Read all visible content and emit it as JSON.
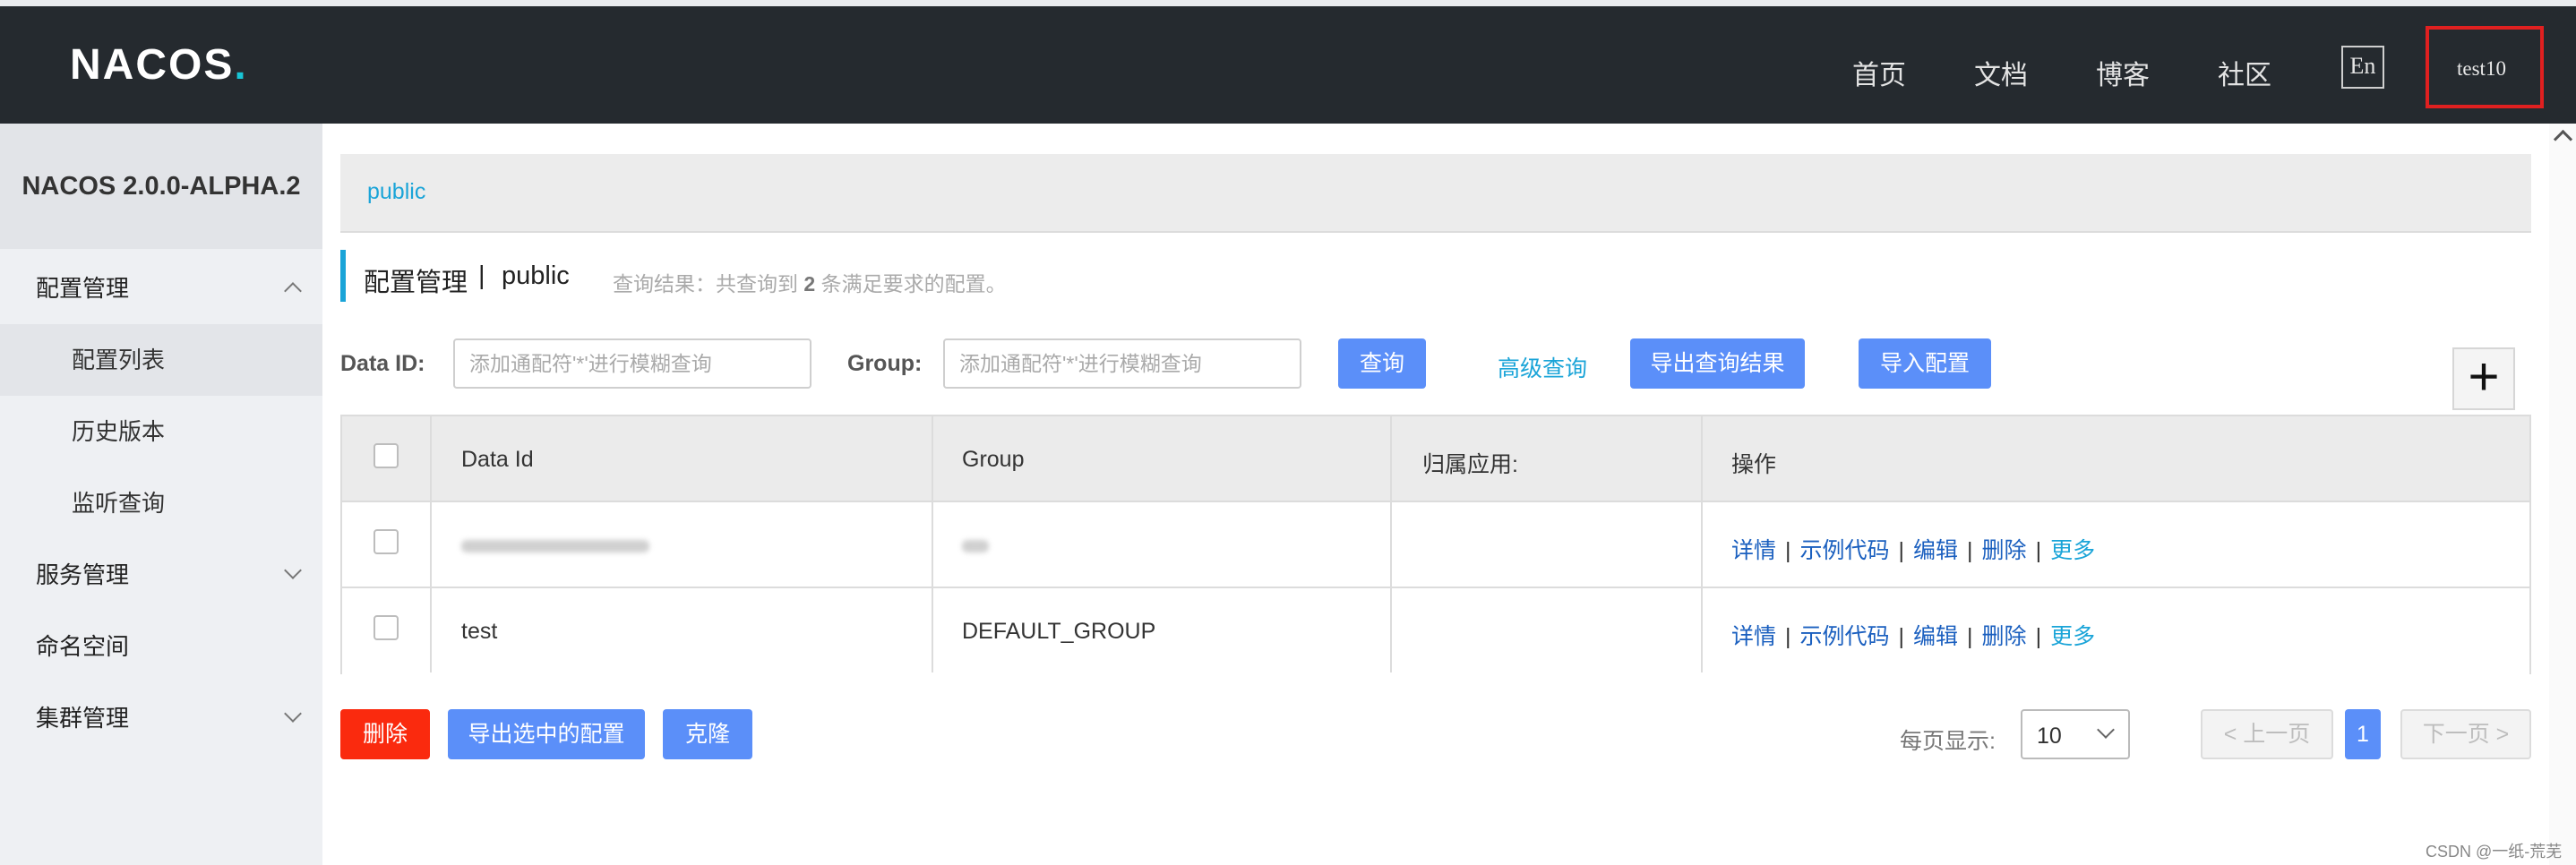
{
  "header": {
    "logo": "NACOS",
    "logo_dot": ".",
    "nav": [
      "首页",
      "文档",
      "博客",
      "社区"
    ],
    "lang": "En",
    "user": "test10"
  },
  "sidebar": {
    "version": "NACOS 2.0.0-ALPHA.2",
    "items": [
      {
        "label": "配置管理"
      },
      {
        "label": "配置列表"
      },
      {
        "label": "历史版本"
      },
      {
        "label": "监听查询"
      },
      {
        "label": "服务管理"
      },
      {
        "label": "命名空间"
      },
      {
        "label": "集群管理"
      }
    ]
  },
  "namespace_tab": "public",
  "title": {
    "main": "配置管理",
    "sep": "|",
    "ns": "public",
    "result_prefix": "查询结果：共查询到",
    "result_count": "2",
    "result_suffix": "条满足要求的配置。"
  },
  "filters": {
    "dataid_label": "Data ID:",
    "dataid_placeholder": "添加通配符'*'进行模糊查询",
    "group_label": "Group:",
    "group_placeholder": "添加通配符'*'进行模糊查询",
    "query_btn": "查询",
    "advanced": "高级查询",
    "export_result": "导出查询结果",
    "import": "导入配置",
    "add": "+"
  },
  "table": {
    "headers": [
      "Data Id",
      "Group",
      "归属应用:",
      "操作"
    ],
    "rows": [
      {
        "data_id": "",
        "group": "",
        "app": ""
      },
      {
        "data_id": "test",
        "group": "DEFAULT_GROUP",
        "app": ""
      }
    ],
    "ops": [
      "详情",
      "示例代码",
      "编辑",
      "删除",
      "更多"
    ],
    "ops_sep": "|"
  },
  "footer": {
    "delete": "删除",
    "export_selected": "导出选中的配置",
    "clone": "克隆",
    "page_size_label": "每页显示:",
    "page_size": "10",
    "prev": "< 上一页",
    "current": "1",
    "next": "下一页 >"
  },
  "watermark": "CSDN @一纸-荒芜",
  "colors": {
    "topbar": "#252a2f",
    "accent": "#5b8ff9",
    "link": "#1aa4d8",
    "danger": "#fa2a0e",
    "highlight_box": "#e02020"
  }
}
